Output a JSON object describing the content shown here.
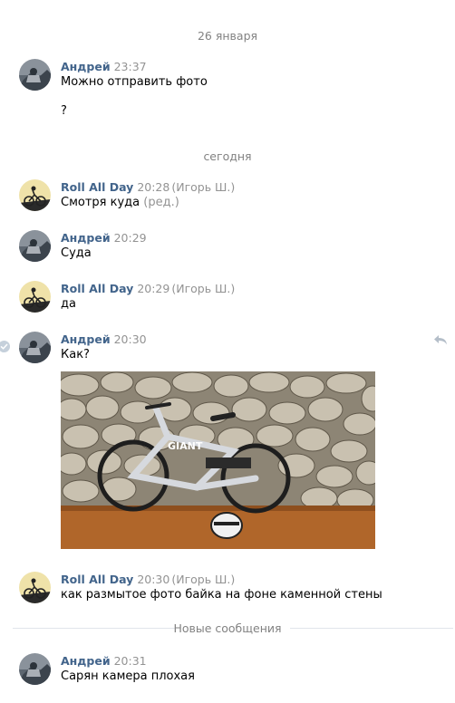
{
  "separators": {
    "date1": "26 января",
    "date2": "сегодня",
    "new_messages": "Новые сообщения"
  },
  "messages": [
    {
      "author": "Андрей",
      "time": "23:37",
      "lines": [
        "Можно отправить фото",
        "?"
      ]
    },
    {
      "author": "Roll All Day",
      "time": "20:28",
      "via": "(Игорь Ш.)",
      "text": "Смотря куда",
      "edited": "(ред.)"
    },
    {
      "author": "Андрей",
      "time": "20:29",
      "text": "Суда"
    },
    {
      "author": "Roll All Day",
      "time": "20:29",
      "via": "(Игорь Ш.)",
      "text": "да"
    },
    {
      "author": "Андрей",
      "time": "20:30",
      "text": "Как?"
    },
    {
      "author": "Roll All Day",
      "time": "20:30",
      "via": "(Игорь Ш.)",
      "text": "как размытое фото байка на фоне каменной стены"
    },
    {
      "author": "Андрей",
      "time": "20:31",
      "text": "Сарян камера плохая"
    }
  ],
  "photo": {
    "brand_text": "GIANT"
  },
  "colors": {
    "author": "#42648b",
    "meta": "#939393",
    "separator": "#828282"
  },
  "icons": {
    "read_check": "check-icon",
    "reply": "reply-icon"
  }
}
